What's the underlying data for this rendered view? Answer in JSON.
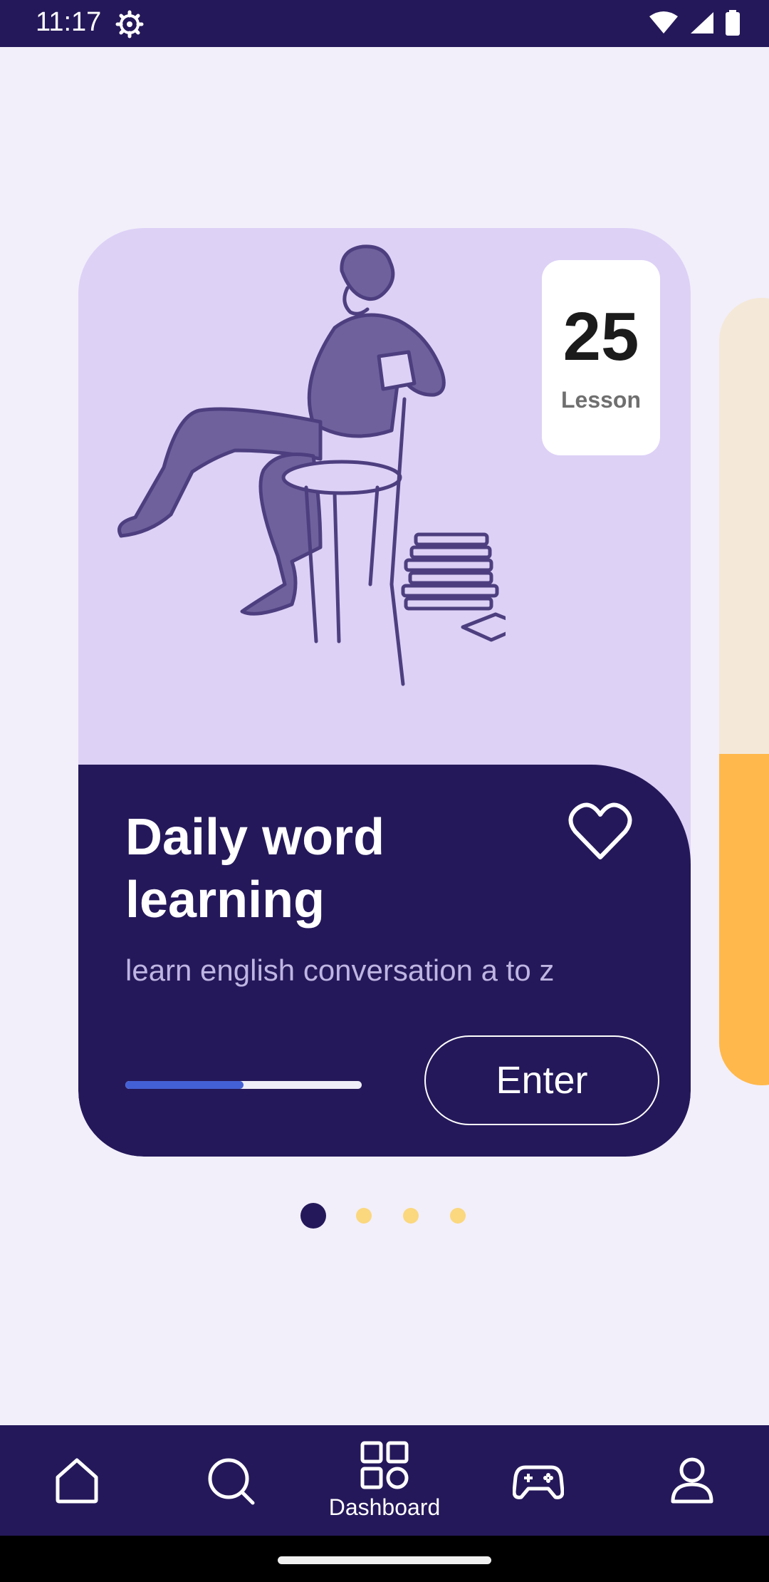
{
  "status_bar": {
    "time": "11:17",
    "icons": [
      "settings-icon",
      "wifi-icon",
      "signal-icon",
      "battery-icon"
    ]
  },
  "card": {
    "lesson_count": "25",
    "lesson_label": "Lesson",
    "title": "Daily word learning",
    "subtitle": "learn english conversation a to z",
    "progress": 0.5,
    "enter_label": "Enter",
    "favorite_icon": "heart-outline-icon",
    "colors": {
      "top": "#ddd1f6",
      "bottom": "#25185a",
      "progress": "#4460d6"
    }
  },
  "peek_card": {
    "colors": {
      "top": "#f4e8d8",
      "bottom": "#ffb84b"
    }
  },
  "pager": {
    "count": 4,
    "active_index": 0
  },
  "bottom_nav": {
    "items": [
      {
        "icon": "home-icon",
        "label": ""
      },
      {
        "icon": "search-icon",
        "label": ""
      },
      {
        "icon": "dashboard-icon",
        "label": "Dashboard"
      },
      {
        "icon": "gamepad-icon",
        "label": ""
      },
      {
        "icon": "profile-icon",
        "label": ""
      }
    ],
    "active_index": 2
  }
}
